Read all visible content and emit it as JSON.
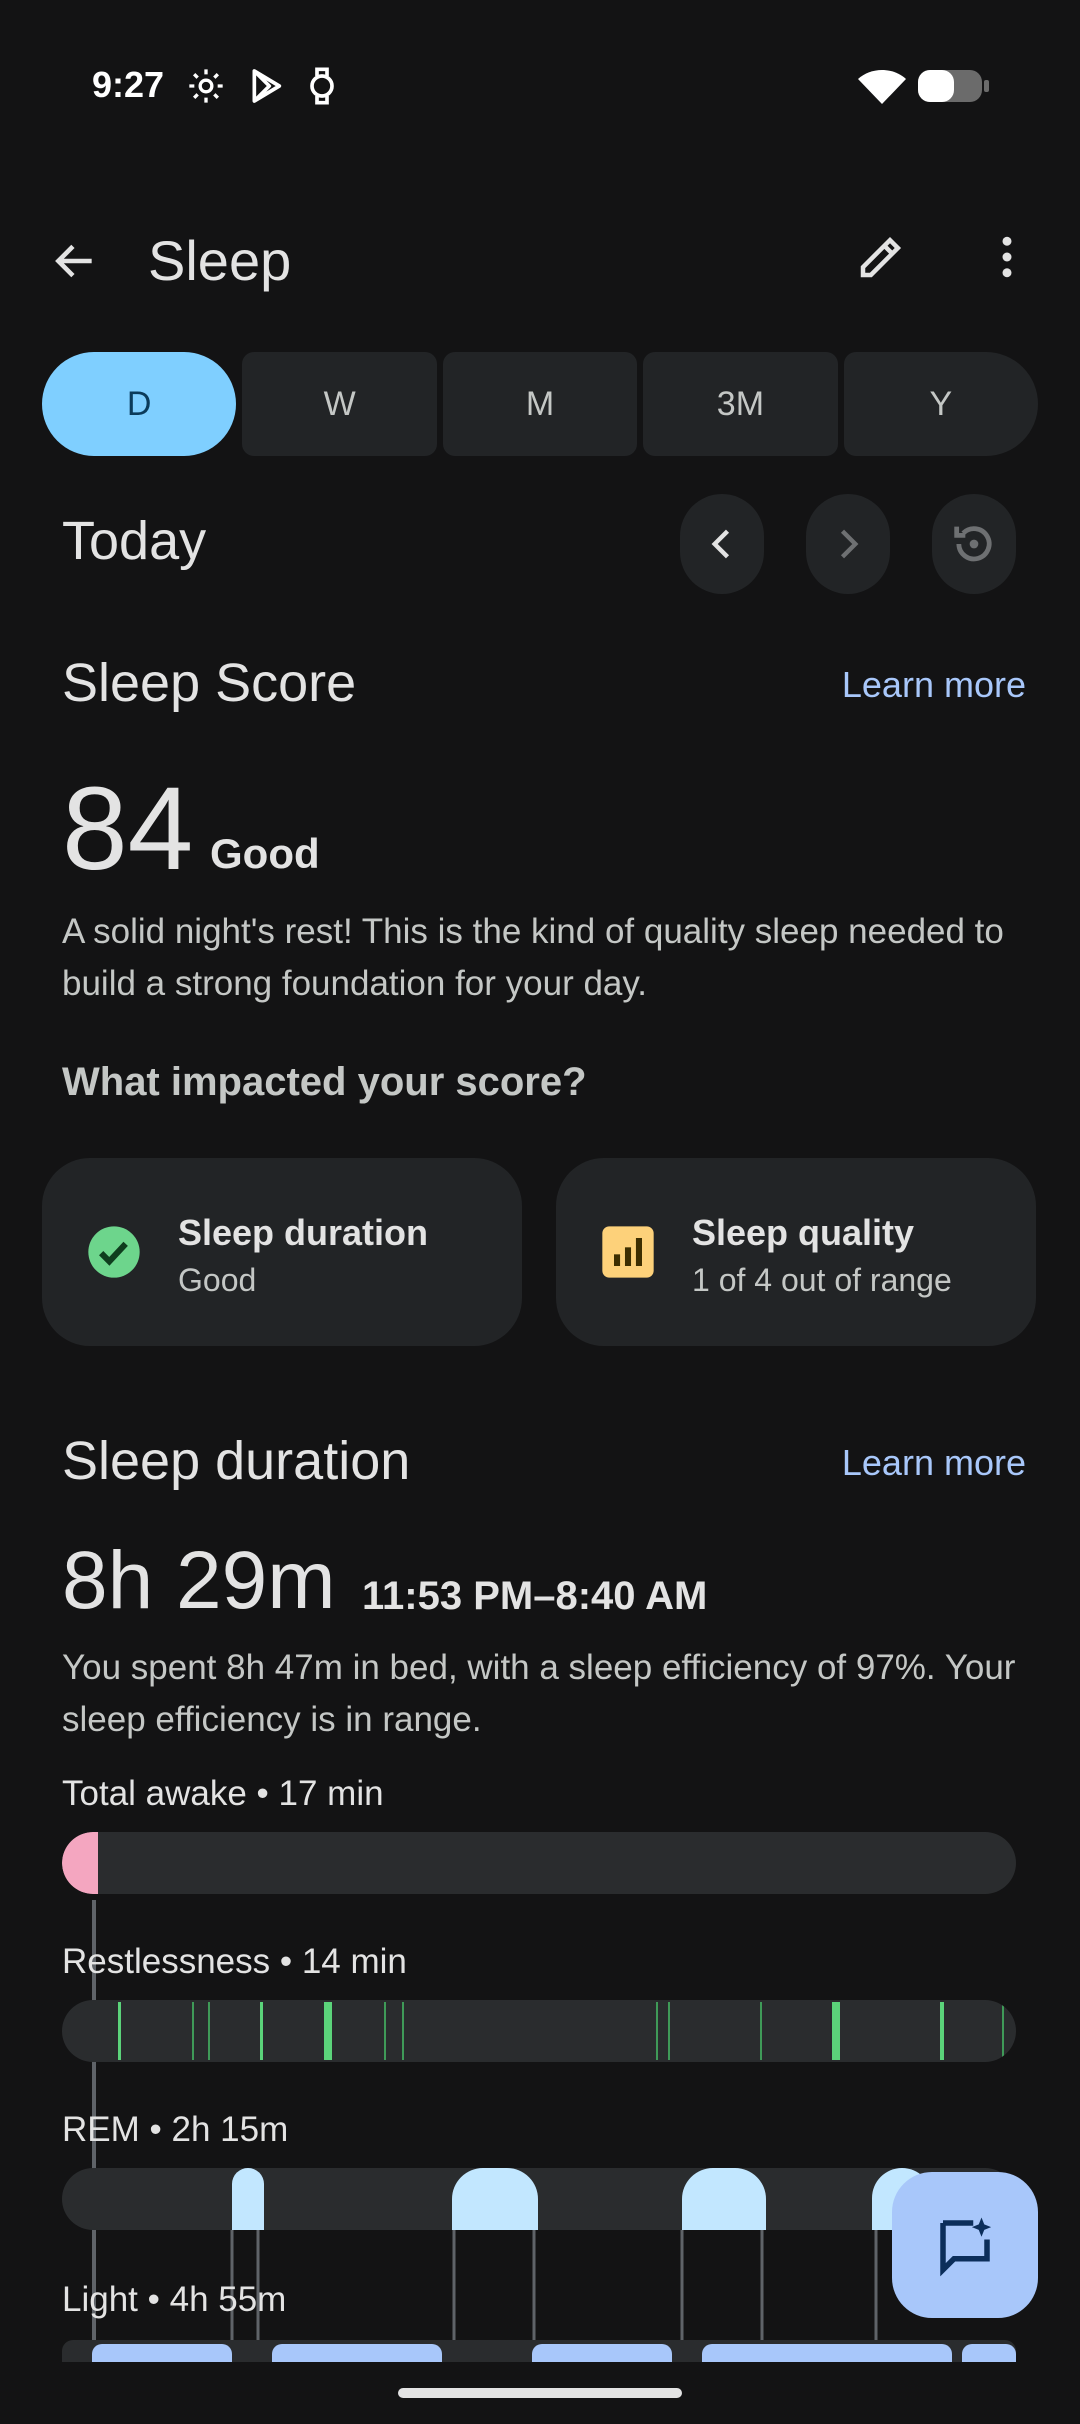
{
  "status_bar": {
    "time": "9:27"
  },
  "app_bar": {
    "title": "Sleep"
  },
  "range_tabs": [
    {
      "label": "D",
      "active": true
    },
    {
      "label": "W",
      "active": false
    },
    {
      "label": "M",
      "active": false
    },
    {
      "label": "3M",
      "active": false
    },
    {
      "label": "Y",
      "active": false
    }
  ],
  "period": {
    "title": "Today"
  },
  "sleep_score": {
    "title": "Sleep Score",
    "learn_more": "Learn more",
    "value": "84",
    "rating": "Good",
    "description": "A solid night's rest! This is the kind of quality sleep needed to build a strong foundation for your day.",
    "impact_heading": "What impacted your score?",
    "factors": [
      {
        "title": "Sleep duration",
        "status": "Good"
      },
      {
        "title": "Sleep quality",
        "status": "1 of 4 out of range"
      }
    ]
  },
  "sleep_duration": {
    "title": "Sleep duration",
    "learn_more": "Learn more",
    "total": "8h 29m",
    "range": "11:53 PM–8:40 AM",
    "description": "You spent 8h 47m in bed, with a sleep efficiency of 97%. Your sleep efficiency is in range.",
    "stages": [
      {
        "label": "Total awake • 17 min"
      },
      {
        "label": "Restlessness • 14 min"
      },
      {
        "label": "REM • 2h 15m"
      },
      {
        "label": "Light • 4h 55m"
      }
    ]
  },
  "colors": {
    "accent": "#7fcfff",
    "awake": "#f4a6c0",
    "restless": "#5bd37a",
    "rem": "#c2e7ff",
    "light": "#a8c7fa",
    "good": "#6dd58c",
    "warning": "#fdd17a"
  }
}
